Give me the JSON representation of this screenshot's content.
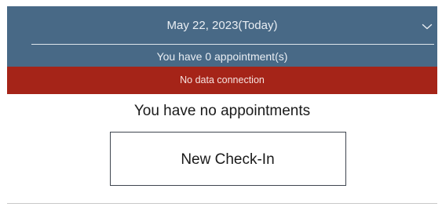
{
  "header": {
    "date_label": "May 22, 2023(Today)",
    "appointment_count_label": "You have 0 appointment(s)",
    "dropdown_icon": "chevron-down-icon",
    "background_color": "#486986"
  },
  "alert": {
    "message": "No data connection",
    "color": "#a52418"
  },
  "main": {
    "empty_message": "You have no appointments",
    "checkin_button_label": "New Check-In"
  }
}
